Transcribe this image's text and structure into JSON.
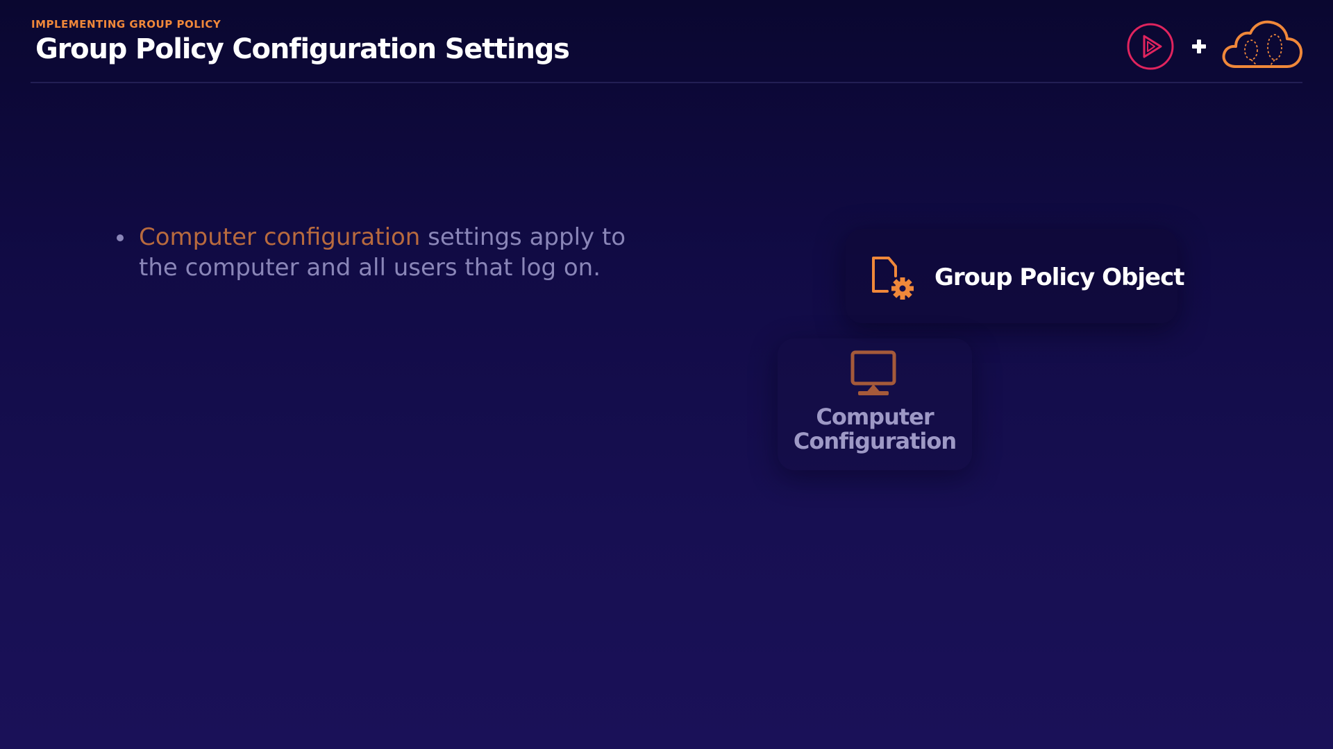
{
  "header": {
    "eyebrow": "IMPLEMENTING GROUP POLICY",
    "title": "Group Policy Configuration Settings"
  },
  "logos": {
    "play_icon": "pluralsight-play-icon",
    "plus_text": "+",
    "cloud_icon": "cloud-skills-icon"
  },
  "bullets": [
    {
      "highlight": "Computer configuration",
      "rest": " settings apply to the computer and all users that log on."
    }
  ],
  "diagram": {
    "gpo": {
      "icon": "document-gear-icon",
      "label": "Group Policy Object"
    },
    "computer_config": {
      "icon": "monitor-icon",
      "label_line1": "Computer",
      "label_line2": "Configuration"
    }
  },
  "colors": {
    "accent_orange": "#f0883a",
    "highlight_rust": "#b86a3e",
    "logo_pink": "#e0245e",
    "muted_text": "#8a86b8",
    "background": "#130d4a"
  }
}
